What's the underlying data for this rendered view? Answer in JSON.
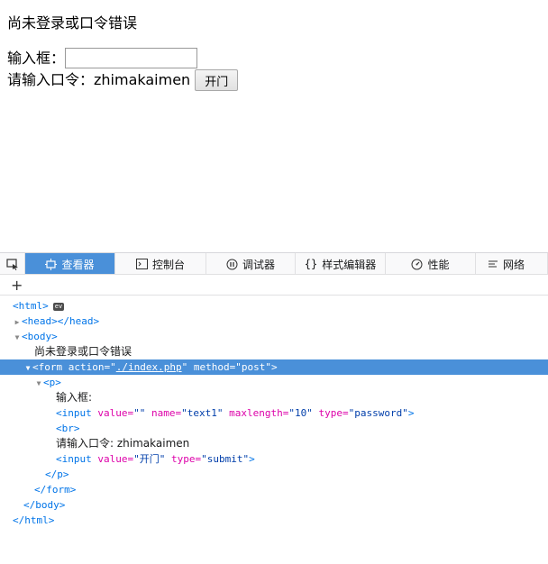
{
  "page": {
    "message": "尚未登录或口令错误",
    "input_label": "输入框：",
    "input_value": "",
    "prompt_label": "请输入口令：zhimakaimen",
    "submit_label": "开门"
  },
  "devtools": {
    "tabs": [
      {
        "label": "查看器",
        "icon": "inspector-icon"
      },
      {
        "label": "控制台",
        "icon": "console-icon"
      },
      {
        "label": "调试器",
        "icon": "debugger-icon"
      },
      {
        "label": "样式编辑器",
        "icon": "style-editor-icon"
      },
      {
        "label": "性能",
        "icon": "performance-icon"
      },
      {
        "label": "网络",
        "icon": "network-icon"
      }
    ],
    "active_tab": "查看器",
    "add_node": "+",
    "ev_badge": "ev",
    "tree": {
      "html_open": "<html>",
      "head": "<head></head>",
      "body_open": "<body>",
      "body_text": "尚未登录或口令错误",
      "form_tag_open": "<form",
      "form_action_attr": "action=",
      "form_action_val": "./index.php",
      "form_method_attr": "method=",
      "form_method_val": "\"post\"",
      "form_close_bracket": ">",
      "p_open": "<p>",
      "p_text1": "输入框:",
      "input1_tag": "<input",
      "input1_value_attr": "value=",
      "input1_value_val": "\"\"",
      "input1_name_attr": "name=",
      "input1_name_val": "\"text1\"",
      "input1_maxlength_attr": "maxlength=",
      "input1_maxlength_val": "\"10\"",
      "input1_type_attr": "type=",
      "input1_type_val": "\"password\"",
      "close_bracket": ">",
      "br": "<br>",
      "p_text2": "请输入口令: zhimakaimen",
      "input2_tag": "<input",
      "input2_value_attr": "value=",
      "input2_value_val": "\"开门\"",
      "input2_type_attr": "type=",
      "input2_type_val": "\"submit\"",
      "p_close": "</p>",
      "form_close": "</form>",
      "body_close": "</body>",
      "html_close": "</html>"
    }
  }
}
